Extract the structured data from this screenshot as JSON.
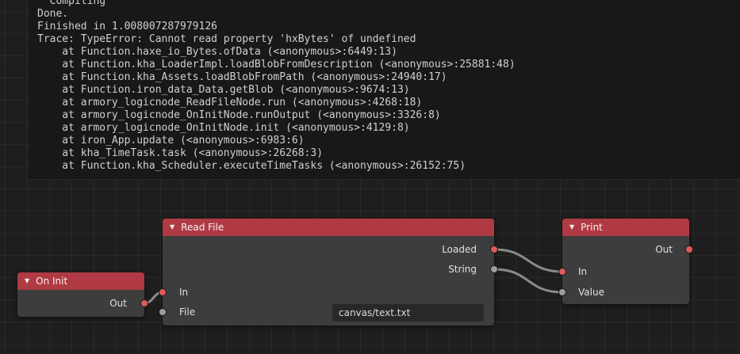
{
  "console": {
    "lines": [
      "  Compiling",
      "Done.",
      "Finished in 1.008007287979126",
      "Trace: TypeError: Cannot read property 'hxBytes' of undefined",
      "    at Function.haxe_io_Bytes.ofData (<anonymous>:6449:13)",
      "    at Function.kha_LoaderImpl.loadBlobFromDescription (<anonymous>:25881:48)",
      "    at Function.kha_Assets.loadBlobFromPath (<anonymous>:24940:17)",
      "    at Function.iron_data_Data.getBlob (<anonymous>:9674:13)",
      "    at armory_logicnode_ReadFileNode.run (<anonymous>:4268:18)",
      "    at armory_logicnode_OnInitNode.runOutput (<anonymous>:3326:8)",
      "    at armory_logicnode_OnInitNode.init (<anonymous>:4129:8)",
      "    at iron_App.update (<anonymous>:6983:6)",
      "    at kha_TimeTask.task (<anonymous>:26268:3)",
      "    at Function.kha_Scheduler.executeTimeTasks (<anonymous>:26152:75)"
    ]
  },
  "nodes": {
    "on_init": {
      "title": "On Init",
      "out_label": "Out"
    },
    "read_file": {
      "title": "Read File",
      "loaded_label": "Loaded",
      "string_label": "String",
      "in_label": "In",
      "file_label": "File",
      "file_value": "canvas/text.txt"
    },
    "print": {
      "title": "Print",
      "out_label": "Out",
      "in_label": "In",
      "value_label": "Value"
    }
  },
  "colors": {
    "header": "#b03a43",
    "node_body": "#3d3d3d",
    "exec_socket": "#e05a5a",
    "data_socket": "#9d9d9d",
    "wire": "#8a8a8a"
  },
  "icons": {
    "collapse": "triangle-down-icon"
  }
}
